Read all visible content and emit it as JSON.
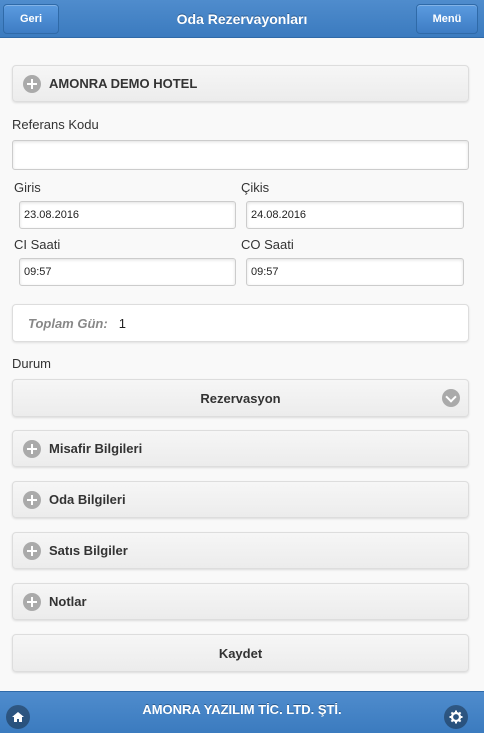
{
  "header": {
    "title": "Oda Rezervayonları",
    "back_label": "Geri",
    "menu_label": "Menü"
  },
  "hotel": {
    "name": "AMONRA DEMO HOTEL"
  },
  "form": {
    "reference_label": "Referans Kodu",
    "reference_value": "",
    "checkin_label": "Giris",
    "checkin_value": "23.08.2016",
    "checkout_label": "Çikis",
    "checkout_value": "24.08.2016",
    "ci_time_label": "CI Saati",
    "ci_time_value": "09:57",
    "co_time_label": "CO Saati",
    "co_time_value": "09:57",
    "total_days_label": "Toplam Gün:",
    "total_days_value": "1",
    "status_label": "Durum",
    "status_value": "Rezervasyon"
  },
  "sections": [
    {
      "label": "Misafir Bilgileri"
    },
    {
      "label": "Oda Bilgileri"
    },
    {
      "label": "Satıs Bilgiler"
    },
    {
      "label": "Notlar"
    }
  ],
  "save_label": "Kaydet",
  "footer": {
    "title": "AMONRA YAZILIM TİC. LTD. ŞTİ."
  },
  "icons": {
    "home": "home-icon",
    "settings": "gear-icon",
    "expand": "plus-icon",
    "dropdown": "chevron-down-icon"
  },
  "colors": {
    "header_bg": "#4a87c8",
    "footer_bg": "#4a87c8",
    "page_bg": "#f9f9f9"
  }
}
